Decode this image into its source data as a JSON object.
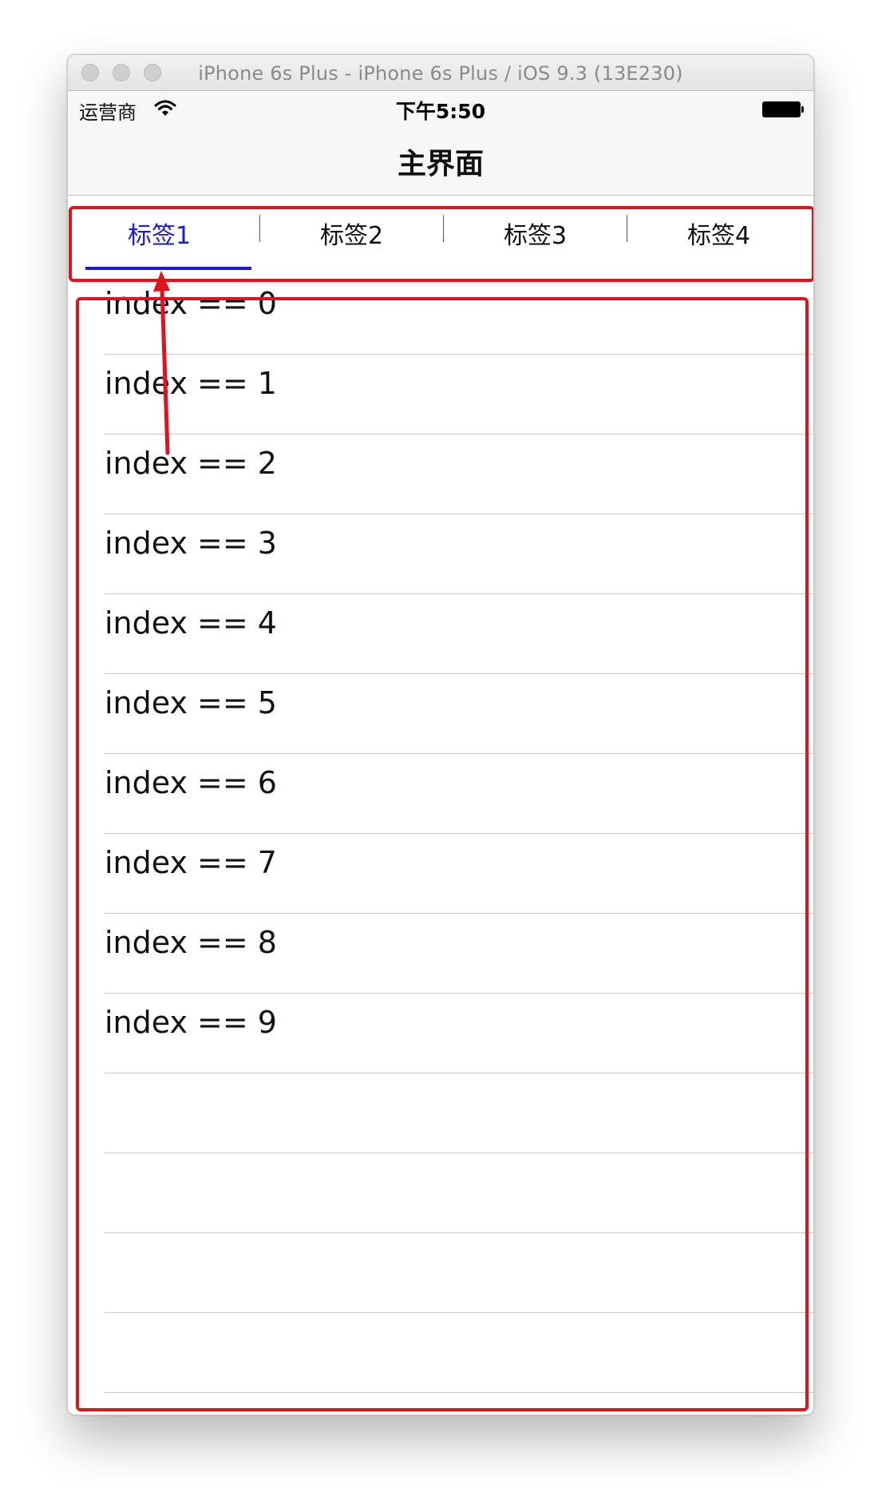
{
  "window": {
    "title": "iPhone 6s Plus - iPhone 6s Plus / iOS 9.3 (13E230)"
  },
  "status_bar": {
    "carrier": "运营商",
    "time": "下午5:50",
    "wifi_icon": "wifi-icon",
    "battery_icon": "battery-icon"
  },
  "nav_bar": {
    "title": "主界面"
  },
  "tabs": [
    {
      "label": "标签1",
      "selected": true
    },
    {
      "label": "标签2",
      "selected": false
    },
    {
      "label": "标签3",
      "selected": false
    },
    {
      "label": "标签4",
      "selected": false
    }
  ],
  "table": {
    "rows": [
      "index == 0",
      "index == 1",
      "index == 2",
      "index == 3",
      "index == 4",
      "index == 5",
      "index == 6",
      "index == 7",
      "index == 8",
      "index == 9",
      "",
      "",
      "",
      ""
    ]
  },
  "colors": {
    "accent": "#1a1ad6",
    "annotation": "#e3111b",
    "separator": "#c8c8c8"
  }
}
